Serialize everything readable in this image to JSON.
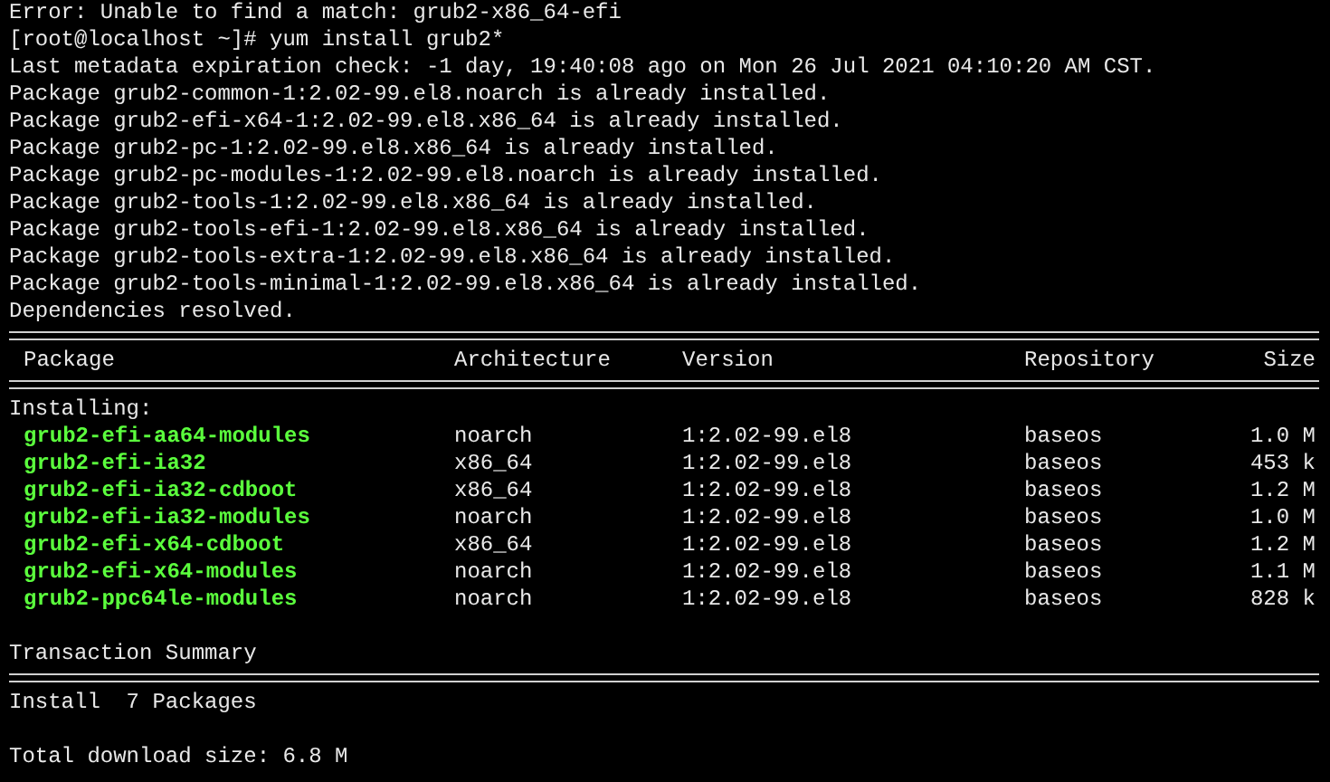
{
  "output_lines": [
    "Error: Unable to find a match: grub2-x86_64-efi",
    "[root@localhost ~]# yum install grub2*",
    "Last metadata expiration check: -1 day, 19:40:08 ago on Mon 26 Jul 2021 04:10:20 AM CST.",
    "Package grub2-common-1:2.02-99.el8.noarch is already installed.",
    "Package grub2-efi-x64-1:2.02-99.el8.x86_64 is already installed.",
    "Package grub2-pc-1:2.02-99.el8.x86_64 is already installed.",
    "Package grub2-pc-modules-1:2.02-99.el8.noarch is already installed.",
    "Package grub2-tools-1:2.02-99.el8.x86_64 is already installed.",
    "Package grub2-tools-efi-1:2.02-99.el8.x86_64 is already installed.",
    "Package grub2-tools-extra-1:2.02-99.el8.x86_64 is already installed.",
    "Package grub2-tools-minimal-1:2.02-99.el8.x86_64 is already installed.",
    "Dependencies resolved."
  ],
  "table": {
    "columns": [
      "Package",
      "Architecture",
      "Version",
      "Repository",
      "Size"
    ],
    "group_label": "Installing:",
    "rows": [
      {
        "package": "grub2-efi-aa64-modules",
        "arch": "noarch",
        "version": "1:2.02-99.el8",
        "repository": "baseos",
        "size": "1.0 M"
      },
      {
        "package": "grub2-efi-ia32",
        "arch": "x86_64",
        "version": "1:2.02-99.el8",
        "repository": "baseos",
        "size": "453 k"
      },
      {
        "package": "grub2-efi-ia32-cdboot",
        "arch": "x86_64",
        "version": "1:2.02-99.el8",
        "repository": "baseos",
        "size": "1.2 M"
      },
      {
        "package": "grub2-efi-ia32-modules",
        "arch": "noarch",
        "version": "1:2.02-99.el8",
        "repository": "baseos",
        "size": "1.0 M"
      },
      {
        "package": "grub2-efi-x64-cdboot",
        "arch": "x86_64",
        "version": "1:2.02-99.el8",
        "repository": "baseos",
        "size": "1.2 M"
      },
      {
        "package": "grub2-efi-x64-modules",
        "arch": "noarch",
        "version": "1:2.02-99.el8",
        "repository": "baseos",
        "size": "1.1 M"
      },
      {
        "package": "grub2-ppc64le-modules",
        "arch": "noarch",
        "version": "1:2.02-99.el8",
        "repository": "baseos",
        "size": "828 k"
      }
    ]
  },
  "summary": {
    "title": "Transaction Summary",
    "install": "Install  7 Packages",
    "total": "Total download size: 6.8 M"
  }
}
